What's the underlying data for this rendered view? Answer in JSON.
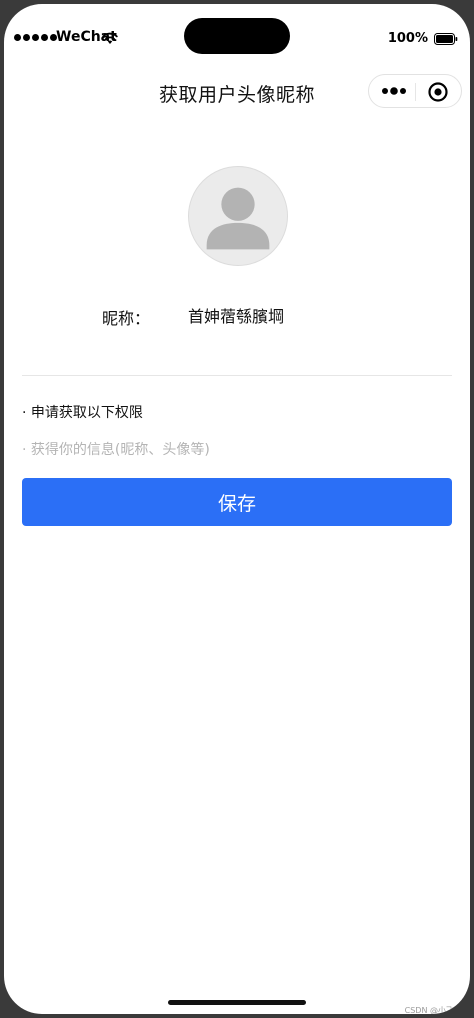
{
  "status_bar": {
    "carrier": "WeChat",
    "battery": "100%"
  },
  "nav": {
    "title": "获取用户头像昵称"
  },
  "profile": {
    "nickname_label": "昵称：",
    "nickname_value": "首妽蓿綔臏堈"
  },
  "permission": {
    "title": "· 申请获取以下权限",
    "description": "· 获得你的信息(昵称、头像等)"
  },
  "actions": {
    "save_label": "保存"
  },
  "watermark": "CSDN @小飞侠",
  "icons": {
    "signal": "signal-dots-icon",
    "wifi": "wifi-icon",
    "battery": "battery-icon",
    "more": "more-dots-icon",
    "close": "target-close-icon",
    "avatar": "default-avatar-icon"
  },
  "colors": {
    "primary": "#2b6ff6",
    "hint_text": "#b4b4b4",
    "avatar_bg": "#ebebeb"
  }
}
